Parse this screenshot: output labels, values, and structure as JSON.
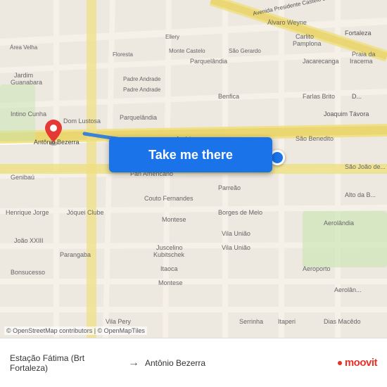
{
  "map": {
    "background_color": "#e8e0d8",
    "attribution": "© OpenStreetMap contributors | © OpenMapTiles"
  },
  "button": {
    "label": "Take me there"
  },
  "bottom_bar": {
    "origin": "Estação Fátima (Brt Fortaleza)",
    "destination": "Antônio Bezerra",
    "arrow": "→",
    "logo_text": "moovit"
  }
}
